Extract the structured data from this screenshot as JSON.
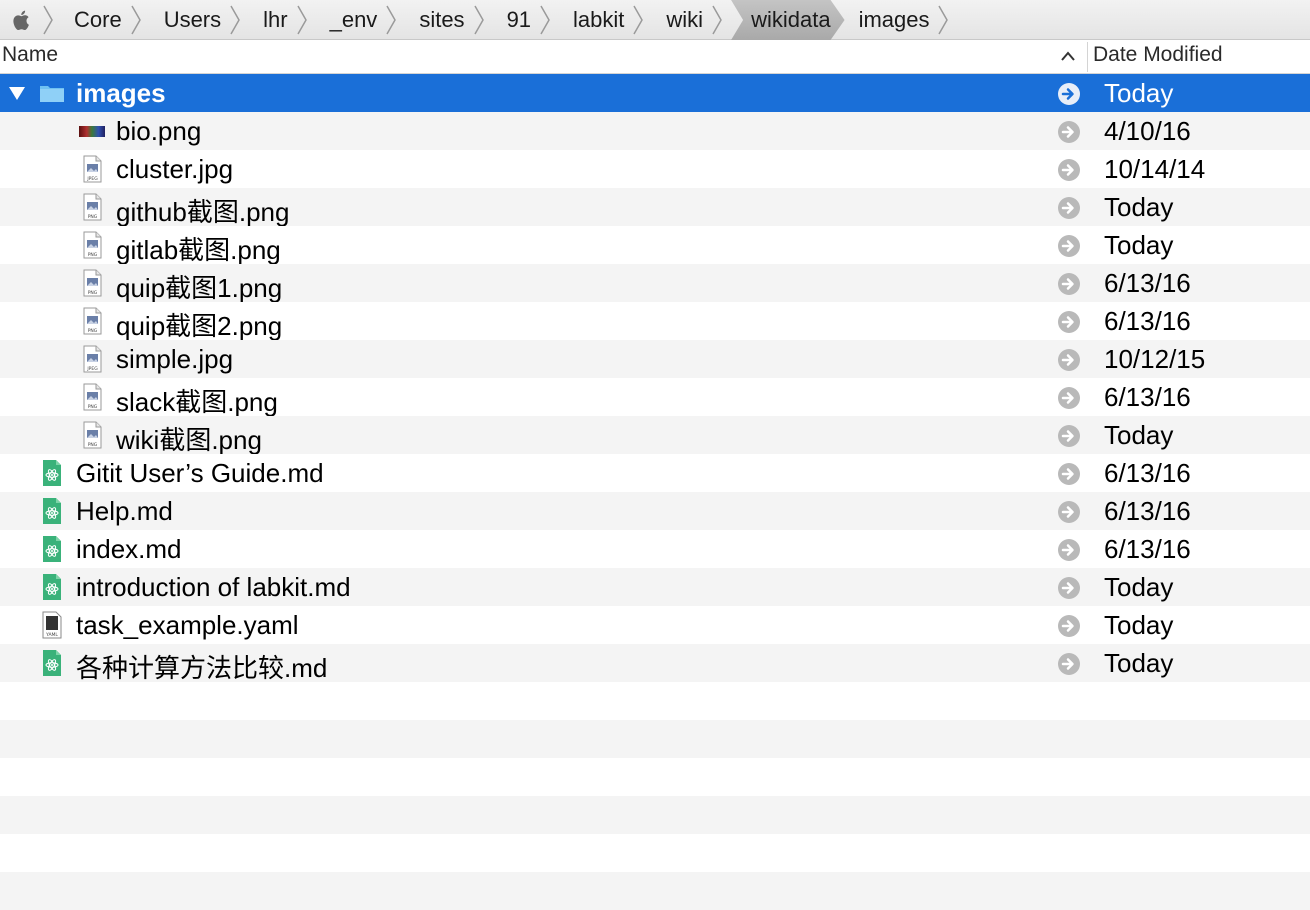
{
  "breadcrumb": {
    "items": [
      "Core",
      "Users",
      "lhr",
      "_env",
      "sites",
      "91",
      "labkit",
      "wiki",
      "wikidata",
      "images"
    ],
    "current_index": 8
  },
  "columns": {
    "name": "Name",
    "date_modified": "Date Modified"
  },
  "colors": {
    "selection": "#1a6fd8",
    "folder": "#6fc1f2",
    "md_icon": "#3ab27a"
  },
  "rows": [
    {
      "name": "images",
      "date": "Today",
      "icon": "folder-icon",
      "indent": 0,
      "selected": true,
      "expanded": true
    },
    {
      "name": "bio.png",
      "date": "4/10/16",
      "icon": "image-thumbnail-icon",
      "indent": 1
    },
    {
      "name": "cluster.jpg",
      "date": "10/14/14",
      "icon": "jpeg-file-icon",
      "indent": 1
    },
    {
      "name": "github截图.png",
      "date": "Today",
      "icon": "png-file-icon",
      "indent": 1
    },
    {
      "name": "gitlab截图.png",
      "date": "Today",
      "icon": "png-file-icon",
      "indent": 1
    },
    {
      "name": "quip截图1.png",
      "date": "6/13/16",
      "icon": "png-file-icon",
      "indent": 1
    },
    {
      "name": "quip截图2.png",
      "date": "6/13/16",
      "icon": "png-file-icon",
      "indent": 1
    },
    {
      "name": "simple.jpg",
      "date": "10/12/15",
      "icon": "jpeg-file-icon",
      "indent": 1
    },
    {
      "name": "slack截图.png",
      "date": "6/13/16",
      "icon": "png-file-icon",
      "indent": 1
    },
    {
      "name": "wiki截图.png",
      "date": "Today",
      "icon": "png-file-icon",
      "indent": 1
    },
    {
      "name": "Gitit User’s Guide.md",
      "date": "6/13/16",
      "icon": "markdown-file-icon",
      "indent": 0
    },
    {
      "name": "Help.md",
      "date": "6/13/16",
      "icon": "markdown-file-icon",
      "indent": 0
    },
    {
      "name": "index.md",
      "date": "6/13/16",
      "icon": "markdown-file-icon",
      "indent": 0
    },
    {
      "name": "introduction of labkit.md",
      "date": "Today",
      "icon": "markdown-file-icon",
      "indent": 0
    },
    {
      "name": "task_example.yaml",
      "date": "Today",
      "icon": "yaml-file-icon",
      "indent": 0
    },
    {
      "name": "各种计算方法比较.md",
      "date": "Today",
      "icon": "markdown-file-icon",
      "indent": 0
    }
  ]
}
